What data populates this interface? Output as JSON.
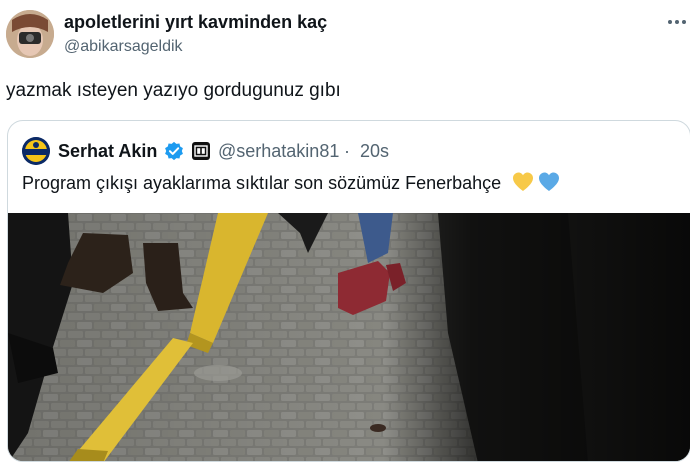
{
  "tweet": {
    "display_name": "apoletlerini yırt kavminden kaç",
    "handle": "@abikarsageldik",
    "text": "yazmak ısteyen yazıyo gordugunuz gıbı",
    "more_icon": "more-horizontal-icon"
  },
  "quote": {
    "display_name": "Serhat Akin",
    "verified_icon": "verified-badge-icon",
    "affiliation_icon": "affiliate-badge-icon",
    "handle": "@serhatakin81",
    "separator": "·",
    "time": "20s",
    "text": "Program çıkışı ayaklarıma sıktılar son sözümüz Fenerbahçe",
    "emojis": [
      "yellow-heart-icon",
      "blue-heart-icon"
    ],
    "colors": {
      "heart_yellow": "#f7c948",
      "heart_blue": "#5aa9e6",
      "verified": "#1d9bf0"
    }
  }
}
